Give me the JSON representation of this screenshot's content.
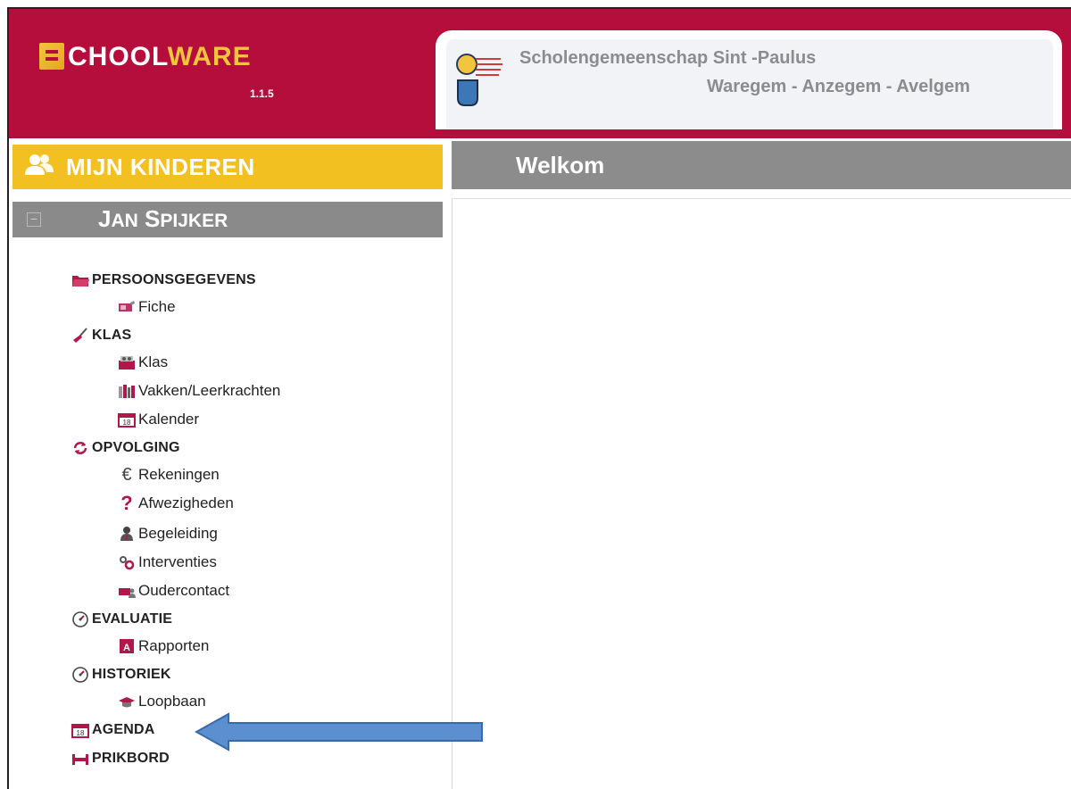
{
  "header": {
    "logo_prefix": "CHOOL",
    "logo_suffix": "WARE",
    "version": "1.1.5",
    "school_name": "Scholengemeenschap Sint -Paulus",
    "school_locations": "Waregem - Anzegem - Avelgem"
  },
  "kids_bar": {
    "label": "MIJN KINDEREN"
  },
  "main": {
    "title": "Welkom"
  },
  "child": {
    "first": "J",
    "first_rest": "AN",
    "last": "S",
    "last_rest": "PIJKER"
  },
  "menu": {
    "persoonsgegevens": "PERSOONSGEGEVENS",
    "fiche": "Fiche",
    "klas_cat": "KLAS",
    "klas": "Klas",
    "vakken": "Vakken/Leerkrachten",
    "kalender": "Kalender",
    "opvolging": "OPVOLGING",
    "rekeningen": "Rekeningen",
    "afwezigheden": "Afwezigheden",
    "begeleiding": "Begeleiding",
    "interventies": "Interventies",
    "oudercontact": "Oudercontact",
    "evaluatie": "EVALUATIE",
    "rapporten": "Rapporten",
    "historiek": "HISTORIEK",
    "loopbaan": "Loopbaan",
    "agenda": "AGENDA",
    "prikbord": "PRIKBORD"
  },
  "colors": {
    "brand_red": "#b50d3c",
    "accent_yellow": "#f2c021",
    "bar_gray": "#8c8c8c",
    "annotation_arrow": "#5b8fd0"
  }
}
